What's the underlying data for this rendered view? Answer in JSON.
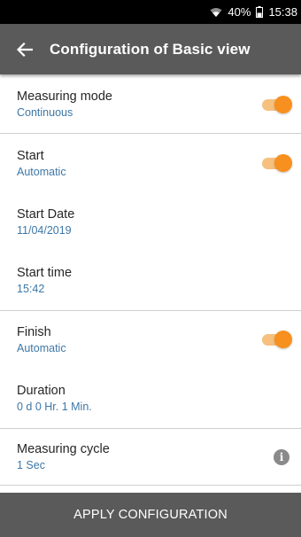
{
  "status_bar": {
    "battery": "40%",
    "time": "15:38"
  },
  "header": {
    "title": "Configuration of Basic view"
  },
  "settings": {
    "measuring_mode": {
      "label": "Measuring mode",
      "value": "Continuous",
      "toggle_on": true
    },
    "start": {
      "label": "Start",
      "value": "Automatic",
      "toggle_on": true
    },
    "start_date": {
      "label": "Start Date",
      "value": "11/04/2019"
    },
    "start_time": {
      "label": "Start time",
      "value": "15:42"
    },
    "finish": {
      "label": "Finish",
      "value": "Automatic",
      "toggle_on": true
    },
    "duration": {
      "label": "Duration",
      "value": "0 d 0 Hr. 1 Min."
    },
    "measuring_cycle": {
      "label": "Measuring cycle",
      "value": "1 Sec",
      "info_icon": "i"
    }
  },
  "footer": {
    "apply_label": "APPLY CONFIGURATION"
  },
  "colors": {
    "accent": "#f7901e",
    "header_bg": "#5a5a5a",
    "value_text": "#3e77a6"
  }
}
